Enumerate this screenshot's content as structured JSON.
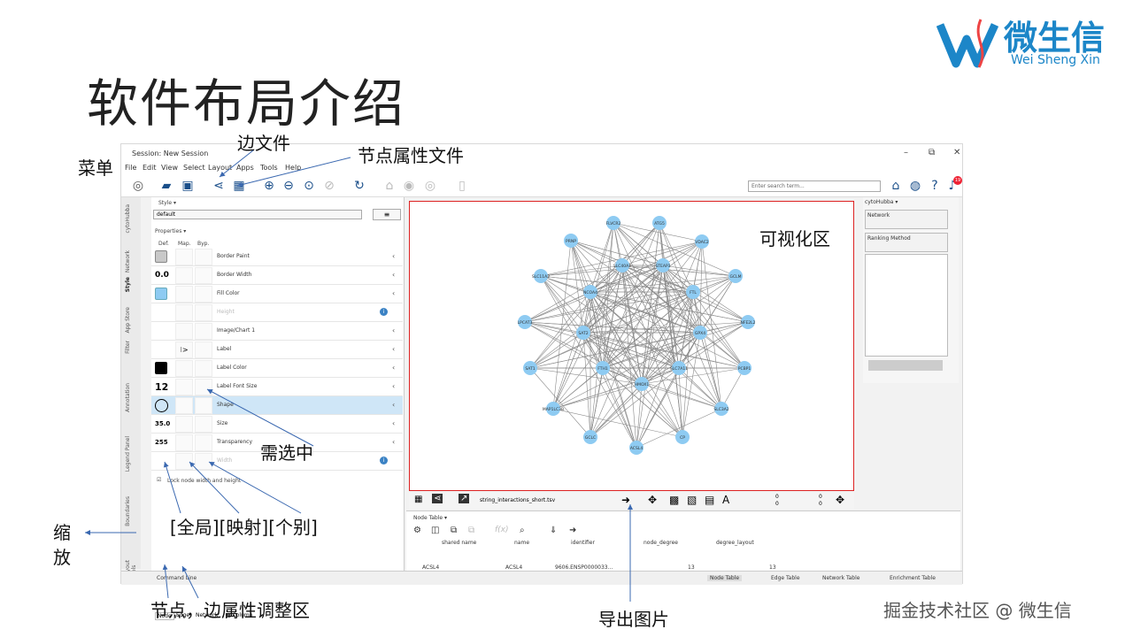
{
  "slide": {
    "title": "软件布局介绍",
    "logo_cn": "微生信",
    "logo_en": "Wei Sheng Xin",
    "watermark": "掘金技术社区 @ 微生信"
  },
  "annotations": {
    "menu": "菜单",
    "edge_file": "边文件",
    "node_attr_file": "节点属性文件",
    "visual_area": "可视化区",
    "need_select": "需选中",
    "scope": "[全局][映射][个别]",
    "zoom": "缩\n放",
    "zoom_1": "缩",
    "zoom_2": "放",
    "node_edge_area": "节点，边属性调整区",
    "export_image": "导出图片"
  },
  "window": {
    "title": "Session: New Session",
    "controls": [
      "–",
      "⧉",
      "✕"
    ],
    "menu": [
      "File",
      "Edit",
      "View",
      "Select",
      "Layout",
      "Apps",
      "Tools",
      "Help"
    ],
    "search_placeholder": "Enter search term...",
    "notification_count": "19"
  },
  "left_tabs": [
    "cytoHubba",
    "Network",
    "Style",
    "App Store",
    "Filter",
    "Annotation",
    "Legend Panel",
    "Boundaries",
    "Layout Tools"
  ],
  "style_panel": {
    "header": "Style ▾",
    "style_name": "default",
    "menu_icon": "≡",
    "properties_label": "Properties ▾",
    "col_def": "Def.",
    "col_map": "Map.",
    "col_byp": "Byp.",
    "rows": [
      {
        "def": "",
        "label": "Border Paint",
        "swatch": "grey"
      },
      {
        "def": "0.0",
        "label": "Border Width"
      },
      {
        "def": "",
        "label": "Fill Color",
        "swatch": "blue"
      },
      {
        "def": "",
        "label": "Height",
        "disabled": true
      },
      {
        "def": "",
        "label": "Image/Chart 1"
      },
      {
        "def": "",
        "label": "Label",
        "map": "⁝>"
      },
      {
        "def": "",
        "label": "Label Color",
        "swatch": "black"
      },
      {
        "def": "12",
        "label": "Label Font Size"
      },
      {
        "def": "",
        "label": "Shape",
        "swatch": "circle",
        "selected": true
      },
      {
        "def": "35.0",
        "label": "Size"
      },
      {
        "def": "255",
        "label": "Transparency"
      },
      {
        "def": "",
        "label": "Width",
        "disabled": true
      }
    ],
    "lock_label": "Lock node width and height",
    "bottom_tabs": [
      "Node",
      "Edge",
      "Network",
      "▦ Column"
    ]
  },
  "network_view": {
    "file": "string_interactions_short.tsv",
    "nodes": [
      "FLVCR2",
      "ATG5",
      "PRNP",
      "VDAC2",
      "SLC40A1",
      "STEAP3",
      "SLC11A2",
      "GCLM",
      "NCOA4",
      "FTL",
      "LPCAT3",
      "NFE2L2",
      "SAT2",
      "GPX4",
      "SAT1",
      "FTH1",
      "SLC7A11",
      "PCBP1",
      "HMOX1",
      "MAP1LC3B",
      "SLC3A2",
      "GCLC",
      "CP",
      "ACSL4"
    ],
    "counts": [
      "0",
      "0",
      "0",
      "0"
    ]
  },
  "right_panel": {
    "header": "cytoHubba ▾",
    "network_label": "Network",
    "ranking_label": "Ranking Method"
  },
  "node_table": {
    "header": "Node Table ▾",
    "columns": [
      "shared name",
      "name",
      "identifier",
      "node_degree",
      "degree_layout"
    ],
    "row": {
      "shared_name": "ACSL4",
      "name": "ACSL4",
      "identifier": "9606.ENSP0000033...",
      "node_degree": "13",
      "degree_layout": "13"
    }
  },
  "status_bar": {
    "command_line": "Command Line",
    "tabs": [
      "Node Table",
      "Edge Table",
      "Network Table",
      "Enrichment Table"
    ]
  }
}
